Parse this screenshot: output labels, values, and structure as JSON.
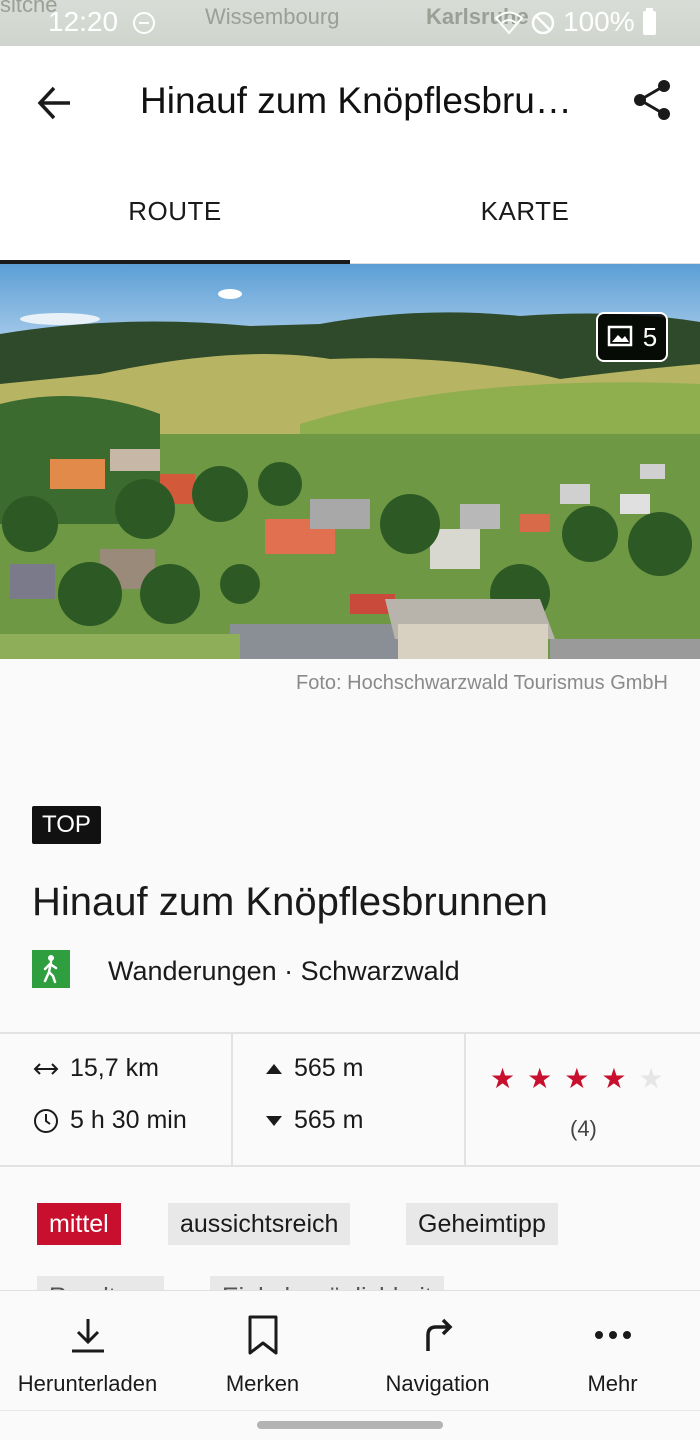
{
  "status_bar": {
    "time": "12:20",
    "battery": "100%",
    "map_labels": [
      "sitche",
      "Wissembourg",
      "Karlsruhe"
    ]
  },
  "app_bar": {
    "title": "Hinauf zum Knöpflesbru…",
    "back_icon": "arrow-left-icon",
    "share_icon": "share-icon"
  },
  "tabs": [
    {
      "label": "ROUTE",
      "active": true
    },
    {
      "label": "KARTE",
      "active": false
    }
  ],
  "hero": {
    "gallery_count": "5",
    "caption": "Foto: Hochschwarzwald Tourismus GmbH"
  },
  "tour": {
    "badge": "TOP",
    "title": "Hinauf zum Knöpflesbrunnen",
    "category": "Wanderungen · Schwarzwald"
  },
  "stats": {
    "distance": "15,7 km",
    "duration": "5 h 30 min",
    "ascent": "565 m",
    "descent": "565 m",
    "rating": 4,
    "rating_max": 5,
    "rating_count": "(4)"
  },
  "tags": [
    "mittel",
    "aussichtsreich",
    "Geheimtipp",
    "Rundtour",
    "Einkehrmöglichkeit"
  ],
  "colors": {
    "accent": "#c8102e",
    "hike_green": "#2e9e3e"
  },
  "bottom_actions": [
    {
      "label": "Herunterladen",
      "icon": "download-icon"
    },
    {
      "label": "Merken",
      "icon": "bookmark-icon"
    },
    {
      "label": "Navigation",
      "icon": "turn-right-icon"
    },
    {
      "label": "Mehr",
      "icon": "more-dots-icon"
    }
  ]
}
